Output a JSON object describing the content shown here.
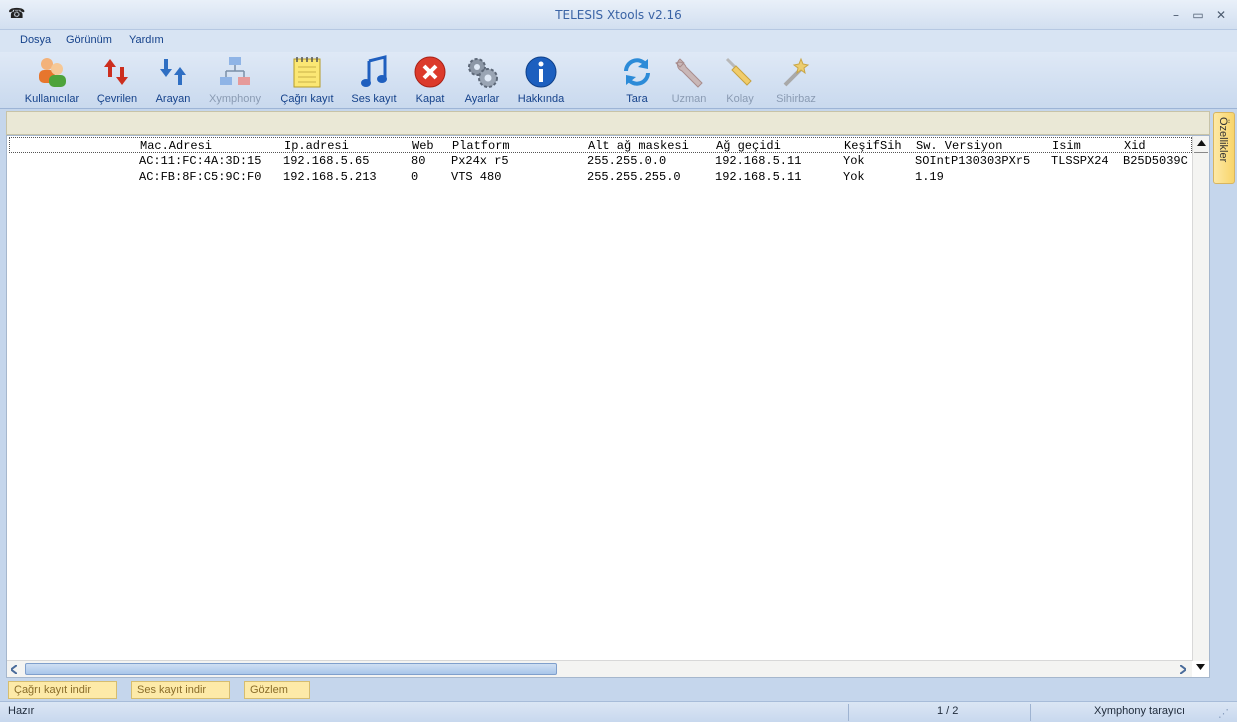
{
  "window": {
    "title": "TELESIS Xtools v2.16",
    "app_icon": "telephone-icon"
  },
  "menu": [
    "Dosya",
    "Görünüm",
    "Yardım"
  ],
  "toolbar": [
    {
      "label": "Kullanıcılar",
      "icon": "users-icon",
      "enabled": true
    },
    {
      "label": "Çevrilen",
      "icon": "outgoing-calls-icon",
      "enabled": true
    },
    {
      "label": "Arayan",
      "icon": "incoming-calls-icon",
      "enabled": true
    },
    {
      "label": "Xymphony",
      "icon": "network-diagram-icon",
      "enabled": false
    },
    {
      "label": "Çağrı kayıt",
      "icon": "notepad-icon",
      "enabled": true
    },
    {
      "label": "Ses kayıt",
      "icon": "music-note-icon",
      "enabled": true
    },
    {
      "label": "Kapat",
      "icon": "close-circle-icon",
      "enabled": true
    },
    {
      "label": "Ayarlar",
      "icon": "gears-icon",
      "enabled": true
    },
    {
      "label": "Hakkında",
      "icon": "info-icon",
      "enabled": true
    },
    {
      "label": "Tara",
      "icon": "refresh-icon",
      "enabled": true
    },
    {
      "label": "Uzman",
      "icon": "wrench-icon",
      "enabled": false
    },
    {
      "label": "Kolay",
      "icon": "screwdriver-icon",
      "enabled": false
    },
    {
      "label": "Sihirbaz",
      "icon": "magic-wand-icon",
      "enabled": false
    }
  ],
  "table": {
    "columns": [
      "Mac.Adresi",
      "Ip.adresi",
      "Web",
      "Platform",
      "Alt ağ maskesi",
      "Ağ geçidi",
      "KeşifSih",
      "Sw. Versiyon",
      "Isim",
      "Xid"
    ],
    "rows": [
      [
        "AC:11:FC:4A:3D:15",
        "192.168.5.65",
        "80",
        "Px24x r5",
        "255.255.0.0",
        "192.168.5.11",
        "Yok",
        "SOIntP130303PXr5",
        "TLSSPX24",
        "B25D5039C"
      ],
      [
        "AC:FB:8F:C5:9C:F0",
        "192.168.5.213",
        "0",
        "VTS 480",
        "255.255.255.0",
        "192.168.5.11",
        "Yok",
        "1.19",
        "",
        ""
      ]
    ]
  },
  "side_tab": "Özellikler",
  "bottom_tabs": [
    "Çağrı kayıt indir",
    "Ses kayıt indir",
    "Gözlem"
  ],
  "status": {
    "left": "Hazır",
    "page": "1 / 2",
    "right": "Xymphony tarayıcı"
  }
}
